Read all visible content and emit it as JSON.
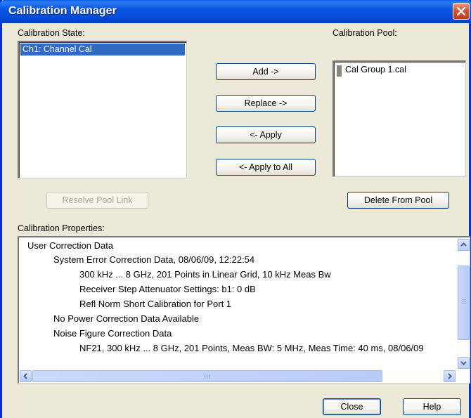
{
  "window": {
    "title": "Calibration Manager"
  },
  "calibration_state": {
    "label": "Calibration State:",
    "items": [
      "Ch1: Channel Cal"
    ]
  },
  "calibration_pool": {
    "label": "Calibration Pool:",
    "items": [
      "Cal Group 1.cal"
    ]
  },
  "buttons": {
    "add": "Add ->",
    "replace": "Replace ->",
    "apply": "<- Apply",
    "apply_all": "<- Apply to All",
    "resolve": "Resolve Pool Link",
    "delete": "Delete From Pool",
    "close": "Close",
    "help": "Help"
  },
  "properties": {
    "label": "Calibration Properties:",
    "lines": [
      "User Correction Data",
      "System Error Correction Data, 08/06/09, 12:22:54",
      "300 kHz ... 8 GHz, 201 Points in Linear Grid, 10 kHz Meas Bw",
      "Receiver Step Attenuator Settings: b1: 0 dB",
      "Refl Norm Short Calibration for Port 1",
      "No Power Correction Data Available",
      "Noise Figure Correction Data",
      "NF21, 300 kHz ... 8 GHz, 201 Points, Meas BW: 5 MHz, Meas Time: 40 ms, 08/06/09"
    ]
  },
  "colors": {
    "titlebar": "#0a57e0",
    "selection": "#316ac5",
    "dialog_bg": "#ece9d8"
  }
}
